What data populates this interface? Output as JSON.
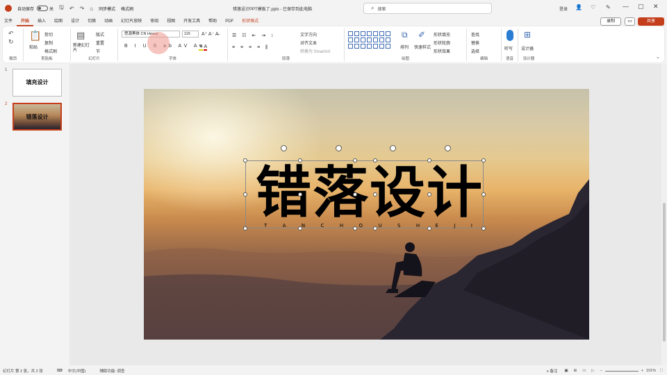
{
  "titlebar": {
    "autosave_label": "自动保存",
    "toggle_label": "关",
    "quick_text": "同步模式",
    "quick_text2": "格式刷",
    "doc_title": "错落设计PPT模板了.pptx - 已保存到此电脑",
    "search_placeholder": "搜索",
    "user": "登录"
  },
  "menu": {
    "tabs": [
      "文件",
      "开始",
      "插入",
      "绘图",
      "设计",
      "切换",
      "动画",
      "幻灯片放映",
      "审阅",
      "视图",
      "开发工具",
      "帮助",
      "PDF",
      "形状格式"
    ],
    "active_index": 1,
    "record_label": "录制",
    "share_label": "共享"
  },
  "ribbon": {
    "groups": {
      "undo": "撤消",
      "clipboard": "剪贴板",
      "slides": "幻灯片",
      "font": "字体",
      "paragraph": "段落",
      "drawing": "绘图",
      "editing": "编辑",
      "voice": "语音",
      "designer": "设计器"
    },
    "paste": "粘贴",
    "cut": "剪切",
    "copy": "复制",
    "format_painter": "格式刷",
    "new_slide": "新建幻灯片",
    "layout": "版式",
    "reset": "重置",
    "section": "节",
    "font_name": "思源黑体 CN Heavy",
    "font_size": "115",
    "text_direction": "文字方向",
    "align_text": "对齐文本",
    "smartart": "转换为 SmartArt",
    "arrange": "排列",
    "quick_styles": "快速样式",
    "shape_fill": "形状填充",
    "shape_outline": "形状轮廓",
    "shape_effects": "形状效果",
    "find": "查找",
    "replace": "替换",
    "select": "选择",
    "dictate": "听写",
    "designer_btn": "设计器"
  },
  "slides": [
    {
      "num": "1",
      "title": "填充设计"
    },
    {
      "num": "2",
      "title": "错落设计"
    }
  ],
  "slide": {
    "title": "错落设计",
    "letters": [
      "T",
      "A",
      "N",
      "C",
      "H",
      "O",
      "U",
      "S",
      "H",
      "E",
      "J",
      "I"
    ]
  },
  "status": {
    "slide_pos": "幻灯片 第 2 张，共 2 张",
    "lang": "中文(中国)",
    "accessibility": "辅助功能: 调查",
    "zoom": "101%"
  }
}
